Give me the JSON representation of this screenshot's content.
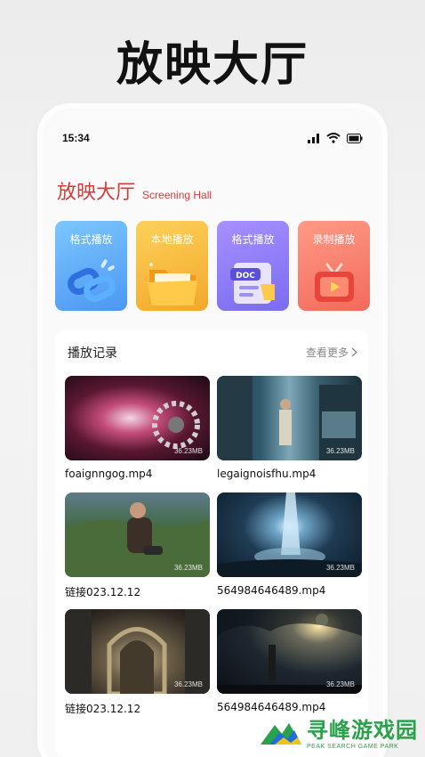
{
  "hero": {
    "title": "放映大厅"
  },
  "status": {
    "time": "15:34"
  },
  "app": {
    "title": "放映大厅",
    "subtitle": "Screening Hall"
  },
  "tiles": [
    {
      "label": "格式播放",
      "color": "#5aa6f6",
      "icon": "chain-link-icon"
    },
    {
      "label": "本地播放",
      "color": "#f7b93a",
      "icon": "folder-icon"
    },
    {
      "label": "格式播放",
      "color": "#8b7cf6",
      "icon": "doc-icon"
    },
    {
      "label": "录制播放",
      "color": "#f57e6c",
      "icon": "tv-play-icon"
    }
  ],
  "history": {
    "title": "播放记录",
    "more": "查看更多",
    "items": [
      {
        "name": "foaignngog.mp4",
        "size": "36.23MB"
      },
      {
        "name": "legaignoisfhu.mp4",
        "size": "36.23MB"
      },
      {
        "name": "链接023.12.12",
        "size": "36.23MB"
      },
      {
        "name": "564984646489.mp4",
        "size": "36.23MB"
      },
      {
        "name": "链接023.12.12",
        "size": "36.23MB"
      },
      {
        "name": "564984646489.mp4",
        "size": "36.23MB"
      }
    ]
  },
  "watermark": {
    "main": "寻峰游戏园",
    "sub": "PEAK SEARCH GAME PARK"
  },
  "colors": {
    "accent": "#d83a3a",
    "watermark": "#2aa14a"
  }
}
